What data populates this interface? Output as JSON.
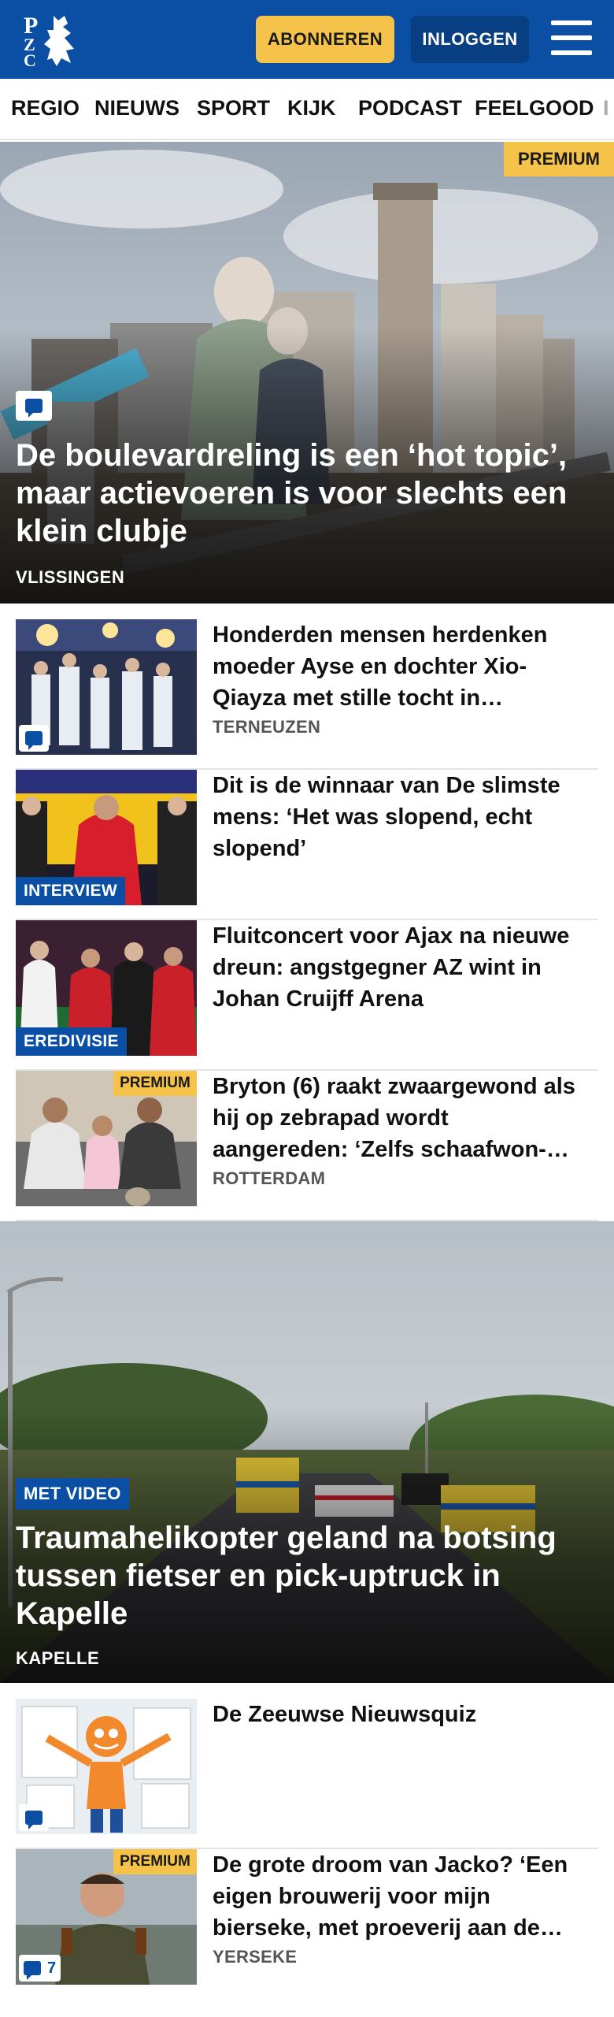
{
  "header": {
    "logo_text": "PZC",
    "subscribe_label": "ABONNEREN",
    "login_label": "INLOGGEN"
  },
  "nav": {
    "items": [
      "REGIO",
      "NIEUWS",
      "SPORT",
      "KIJK",
      "PODCAST",
      "FEELGOOD",
      "I"
    ]
  },
  "colors": {
    "brand_blue": "#0a4fa3",
    "premium_yellow": "#f5c24a"
  },
  "hero1": {
    "premium": "PREMIUM",
    "title": "De boulevardreling is een ‘hot topic’, maar actievoeren is voor slechts een klein clubje",
    "location": "VLISSINGEN",
    "icon": "comment-icon"
  },
  "articles": [
    {
      "title": "Honderden mensen herdenken moeder Ayse en dochter Xio-Qiayza met stille tocht in…",
      "location": "TERNEUZEN",
      "icon": "comment-icon"
    },
    {
      "title": "Dit is de winnaar van De slimste mens: ‘Het was slopend, echt slopend’",
      "tag": "INTERVIEW"
    },
    {
      "title": "Fluitconcert voor Ajax na nieuwe dreun: angstgegner AZ wint in Johan Cruijff Arena",
      "tag": "EREDIVISIE"
    },
    {
      "title": "Bryton (6) raakt zwaargewond als hij op zebrapad wordt aangereden: ‘Zelfs schaafwon-…",
      "location": "ROTTERDAM",
      "premium": "PREMIUM"
    }
  ],
  "hero2": {
    "tag": "MET VIDEO",
    "title": "Traumahelikopter geland na botsing tussen fietser en pick-uptruck in Kapelle",
    "location": "KAPELLE"
  },
  "articles2": [
    {
      "title": "De Zeeuwse Nieuwsquiz",
      "icon": "comment-icon"
    },
    {
      "title": "De grote droom van Jacko? ‘Een eigen brouwerij voor mijn bierseke, met proeverij aan de…",
      "location": "YERSEKE",
      "premium": "PREMIUM",
      "comment_count": "7"
    }
  ]
}
